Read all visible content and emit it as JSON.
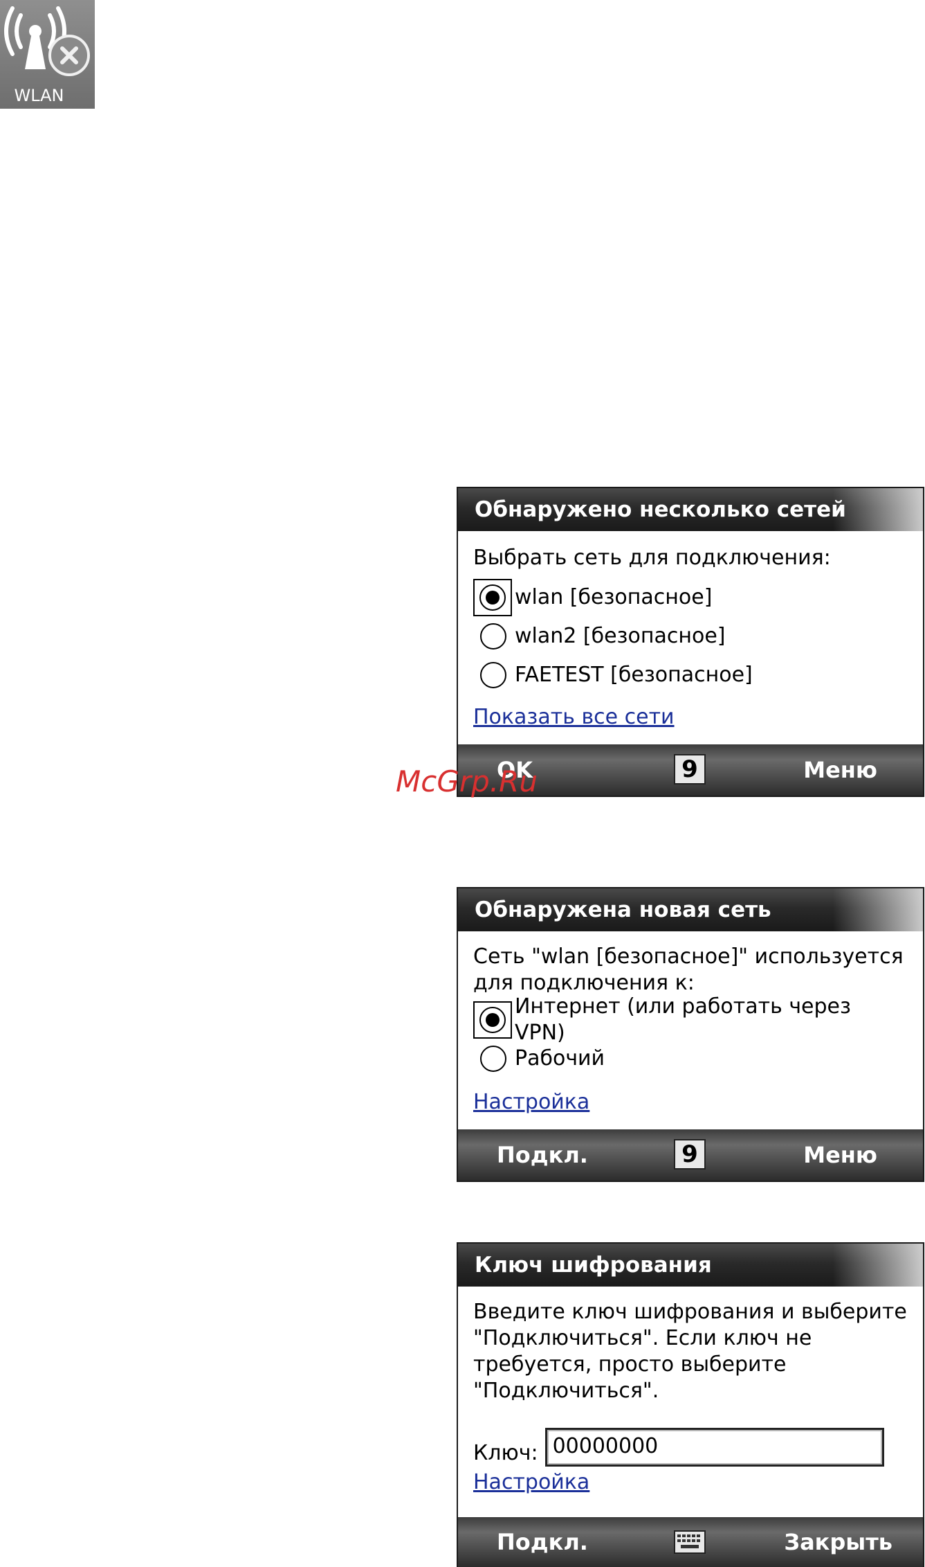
{
  "wlan_icon": {
    "label": "WLAN"
  },
  "watermark": "McGrp.Ru",
  "screen1": {
    "title": "Обнаружено несколько сетей",
    "prompt": "Выбрать сеть для подключения:",
    "networks": [
      {
        "label": "wlan [безопасное]",
        "selected": true
      },
      {
        "label": "wlan2 [безопасное]",
        "selected": false
      },
      {
        "label": "FAETEST [безопасное]",
        "selected": false
      }
    ],
    "link": "Показать все сети",
    "softkeys": {
      "left": "OK",
      "right": "Меню",
      "center": "9"
    }
  },
  "screen2": {
    "title": "Обнаружена новая сеть",
    "prompt_line1": "Сеть \"wlan [безопасное]\" используется",
    "prompt_line2": "для подключения к:",
    "options": [
      {
        "label": "Интернет (или работать через VPN)",
        "selected": true
      },
      {
        "label": "Рабочий",
        "selected": false
      }
    ],
    "link": "Настройка",
    "softkeys": {
      "left": "Подкл.",
      "right": "Меню",
      "center": "9"
    }
  },
  "screen3": {
    "title": "Ключ шифрования",
    "text_line1": "Введите ключ шифрования и выберите",
    "text_line2": "\"Подключиться\". Если ключ не",
    "text_line3": "требуется, просто выберите",
    "text_line4": "\"Подключиться\".",
    "key_label": "Ключ:",
    "key_value": "00000000",
    "link": "Настройка",
    "softkeys": {
      "left": "Подкл.",
      "right": "Закрыть"
    }
  }
}
